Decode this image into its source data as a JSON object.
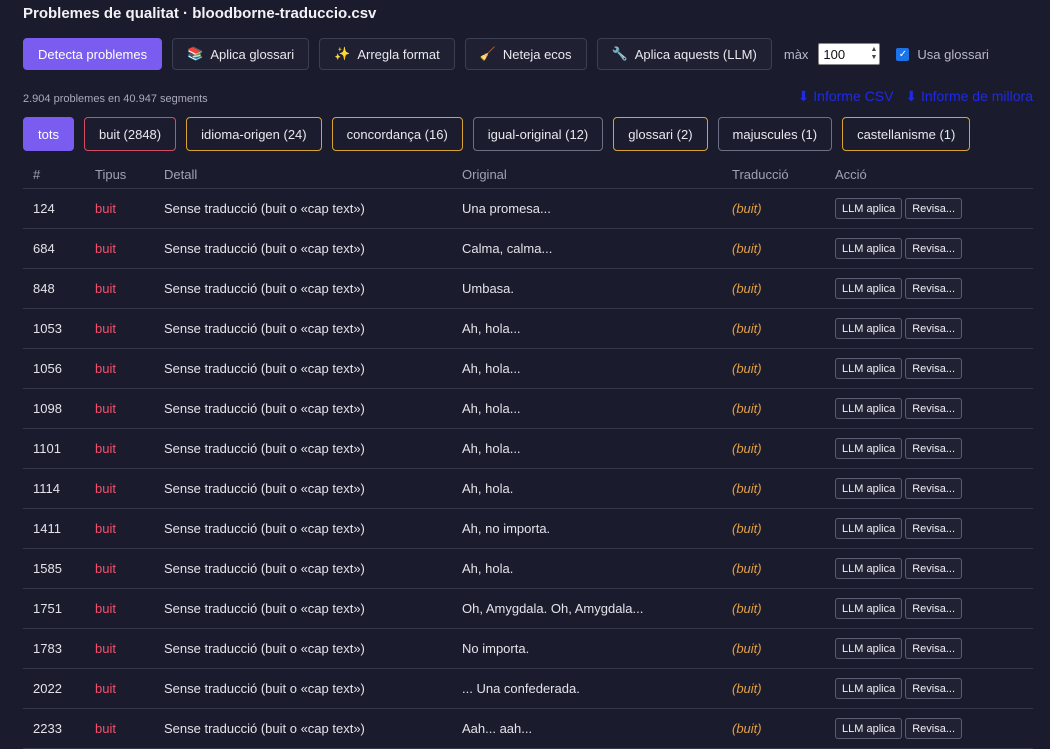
{
  "title": "Problemes de qualitat · bloodborne-traduccio.csv",
  "toolbar": {
    "detect": "Detecta problemes",
    "glossary": "Aplica glossari",
    "format": "Arregla format",
    "echoes": "Neteja ecos",
    "llm": "Aplica aquests (LLM)",
    "max_label": "màx",
    "max_value": "100",
    "use_glossary": "Usa glossari"
  },
  "summary": "2.904 problemes en 40.947 segments",
  "links": {
    "csv": "⬇ Informe CSV",
    "improve": "⬇ Informe de millora"
  },
  "filters": [
    {
      "label": "tots"
    },
    {
      "label": "buit (2848)"
    },
    {
      "label": "idioma-origen (24)"
    },
    {
      "label": "concordança (16)"
    },
    {
      "label": "igual-original (12)"
    },
    {
      "label": "glossari (2)"
    },
    {
      "label": "majuscules (1)"
    },
    {
      "label": "castellanisme (1)"
    }
  ],
  "table": {
    "headers": [
      "#",
      "Tipus",
      "Detall",
      "Original",
      "Traducció",
      "Acció"
    ],
    "action_llm": "LLM aplica",
    "action_review": "Revisa...",
    "rows": [
      {
        "id": "124",
        "type": "buit",
        "detail": "Sense traducció (buit o «cap text»)",
        "original": "Una promesa...",
        "translation": "(buit)"
      },
      {
        "id": "684",
        "type": "buit",
        "detail": "Sense traducció (buit o «cap text»)",
        "original": "Calma, calma...",
        "translation": "(buit)"
      },
      {
        "id": "848",
        "type": "buit",
        "detail": "Sense traducció (buit o «cap text»)",
        "original": "Umbasa.",
        "translation": "(buit)"
      },
      {
        "id": "1053",
        "type": "buit",
        "detail": "Sense traducció (buit o «cap text»)",
        "original": "Ah, hola...",
        "translation": "(buit)"
      },
      {
        "id": "1056",
        "type": "buit",
        "detail": "Sense traducció (buit o «cap text»)",
        "original": "Ah, hola...",
        "translation": "(buit)"
      },
      {
        "id": "1098",
        "type": "buit",
        "detail": "Sense traducció (buit o «cap text»)",
        "original": "Ah, hola...",
        "translation": "(buit)"
      },
      {
        "id": "1101",
        "type": "buit",
        "detail": "Sense traducció (buit o «cap text»)",
        "original": "Ah, hola...",
        "translation": "(buit)"
      },
      {
        "id": "1114",
        "type": "buit",
        "detail": "Sense traducció (buit o «cap text»)",
        "original": "Ah, hola.",
        "translation": "(buit)"
      },
      {
        "id": "1411",
        "type": "buit",
        "detail": "Sense traducció (buit o «cap text»)",
        "original": "Ah, no importa.",
        "translation": "(buit)"
      },
      {
        "id": "1585",
        "type": "buit",
        "detail": "Sense traducció (buit o «cap text»)",
        "original": "Ah, hola.",
        "translation": "(buit)"
      },
      {
        "id": "1751",
        "type": "buit",
        "detail": "Sense traducció (buit o «cap text»)",
        "original": "Oh, Amygdala. Oh, Amygdala...",
        "translation": "(buit)"
      },
      {
        "id": "1783",
        "type": "buit",
        "detail": "Sense traducció (buit o «cap text»)",
        "original": "No importa.",
        "translation": "(buit)"
      },
      {
        "id": "2022",
        "type": "buit",
        "detail": "Sense traducció (buit o «cap text»)",
        "original": "... Una confederada.",
        "translation": "(buit)"
      },
      {
        "id": "2233",
        "type": "buit",
        "detail": "Sense traducció (buit o «cap text»)",
        "original": "Aah... aah...",
        "translation": "(buit)"
      }
    ]
  }
}
